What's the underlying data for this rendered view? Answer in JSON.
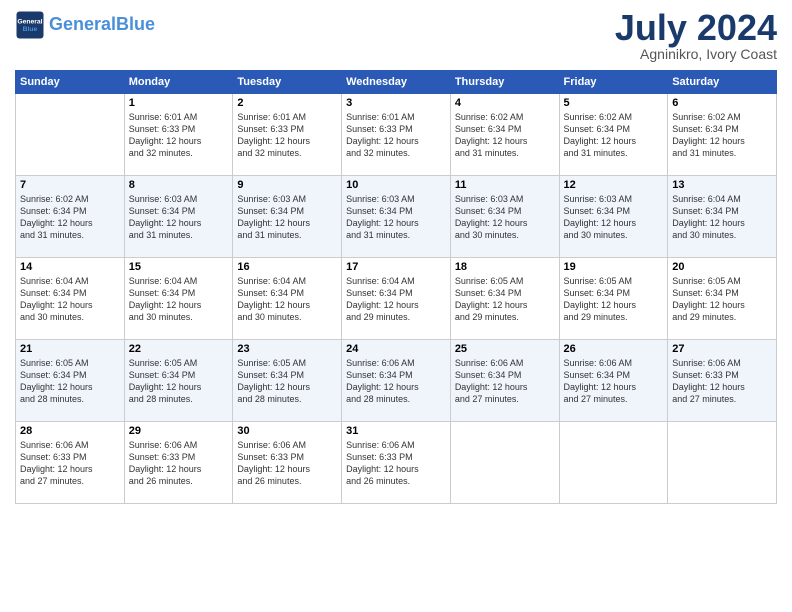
{
  "header": {
    "logo_line1": "General",
    "logo_line2": "Blue",
    "month_year": "July 2024",
    "location": "Agninikro, Ivory Coast"
  },
  "days_of_week": [
    "Sunday",
    "Monday",
    "Tuesday",
    "Wednesday",
    "Thursday",
    "Friday",
    "Saturday"
  ],
  "weeks": [
    [
      {
        "day": "",
        "info": ""
      },
      {
        "day": "1",
        "info": "Sunrise: 6:01 AM\nSunset: 6:33 PM\nDaylight: 12 hours\nand 32 minutes."
      },
      {
        "day": "2",
        "info": "Sunrise: 6:01 AM\nSunset: 6:33 PM\nDaylight: 12 hours\nand 32 minutes."
      },
      {
        "day": "3",
        "info": "Sunrise: 6:01 AM\nSunset: 6:33 PM\nDaylight: 12 hours\nand 32 minutes."
      },
      {
        "day": "4",
        "info": "Sunrise: 6:02 AM\nSunset: 6:34 PM\nDaylight: 12 hours\nand 31 minutes."
      },
      {
        "day": "5",
        "info": "Sunrise: 6:02 AM\nSunset: 6:34 PM\nDaylight: 12 hours\nand 31 minutes."
      },
      {
        "day": "6",
        "info": "Sunrise: 6:02 AM\nSunset: 6:34 PM\nDaylight: 12 hours\nand 31 minutes."
      }
    ],
    [
      {
        "day": "7",
        "info": "Sunrise: 6:02 AM\nSunset: 6:34 PM\nDaylight: 12 hours\nand 31 minutes."
      },
      {
        "day": "8",
        "info": "Sunrise: 6:03 AM\nSunset: 6:34 PM\nDaylight: 12 hours\nand 31 minutes."
      },
      {
        "day": "9",
        "info": "Sunrise: 6:03 AM\nSunset: 6:34 PM\nDaylight: 12 hours\nand 31 minutes."
      },
      {
        "day": "10",
        "info": "Sunrise: 6:03 AM\nSunset: 6:34 PM\nDaylight: 12 hours\nand 31 minutes."
      },
      {
        "day": "11",
        "info": "Sunrise: 6:03 AM\nSunset: 6:34 PM\nDaylight: 12 hours\nand 30 minutes."
      },
      {
        "day": "12",
        "info": "Sunrise: 6:03 AM\nSunset: 6:34 PM\nDaylight: 12 hours\nand 30 minutes."
      },
      {
        "day": "13",
        "info": "Sunrise: 6:04 AM\nSunset: 6:34 PM\nDaylight: 12 hours\nand 30 minutes."
      }
    ],
    [
      {
        "day": "14",
        "info": "Sunrise: 6:04 AM\nSunset: 6:34 PM\nDaylight: 12 hours\nand 30 minutes."
      },
      {
        "day": "15",
        "info": "Sunrise: 6:04 AM\nSunset: 6:34 PM\nDaylight: 12 hours\nand 30 minutes."
      },
      {
        "day": "16",
        "info": "Sunrise: 6:04 AM\nSunset: 6:34 PM\nDaylight: 12 hours\nand 30 minutes."
      },
      {
        "day": "17",
        "info": "Sunrise: 6:04 AM\nSunset: 6:34 PM\nDaylight: 12 hours\nand 29 minutes."
      },
      {
        "day": "18",
        "info": "Sunrise: 6:05 AM\nSunset: 6:34 PM\nDaylight: 12 hours\nand 29 minutes."
      },
      {
        "day": "19",
        "info": "Sunrise: 6:05 AM\nSunset: 6:34 PM\nDaylight: 12 hours\nand 29 minutes."
      },
      {
        "day": "20",
        "info": "Sunrise: 6:05 AM\nSunset: 6:34 PM\nDaylight: 12 hours\nand 29 minutes."
      }
    ],
    [
      {
        "day": "21",
        "info": "Sunrise: 6:05 AM\nSunset: 6:34 PM\nDaylight: 12 hours\nand 28 minutes."
      },
      {
        "day": "22",
        "info": "Sunrise: 6:05 AM\nSunset: 6:34 PM\nDaylight: 12 hours\nand 28 minutes."
      },
      {
        "day": "23",
        "info": "Sunrise: 6:05 AM\nSunset: 6:34 PM\nDaylight: 12 hours\nand 28 minutes."
      },
      {
        "day": "24",
        "info": "Sunrise: 6:06 AM\nSunset: 6:34 PM\nDaylight: 12 hours\nand 28 minutes."
      },
      {
        "day": "25",
        "info": "Sunrise: 6:06 AM\nSunset: 6:34 PM\nDaylight: 12 hours\nand 27 minutes."
      },
      {
        "day": "26",
        "info": "Sunrise: 6:06 AM\nSunset: 6:34 PM\nDaylight: 12 hours\nand 27 minutes."
      },
      {
        "day": "27",
        "info": "Sunrise: 6:06 AM\nSunset: 6:33 PM\nDaylight: 12 hours\nand 27 minutes."
      }
    ],
    [
      {
        "day": "28",
        "info": "Sunrise: 6:06 AM\nSunset: 6:33 PM\nDaylight: 12 hours\nand 27 minutes."
      },
      {
        "day": "29",
        "info": "Sunrise: 6:06 AM\nSunset: 6:33 PM\nDaylight: 12 hours\nand 26 minutes."
      },
      {
        "day": "30",
        "info": "Sunrise: 6:06 AM\nSunset: 6:33 PM\nDaylight: 12 hours\nand 26 minutes."
      },
      {
        "day": "31",
        "info": "Sunrise: 6:06 AM\nSunset: 6:33 PM\nDaylight: 12 hours\nand 26 minutes."
      },
      {
        "day": "",
        "info": ""
      },
      {
        "day": "",
        "info": ""
      },
      {
        "day": "",
        "info": ""
      }
    ]
  ]
}
